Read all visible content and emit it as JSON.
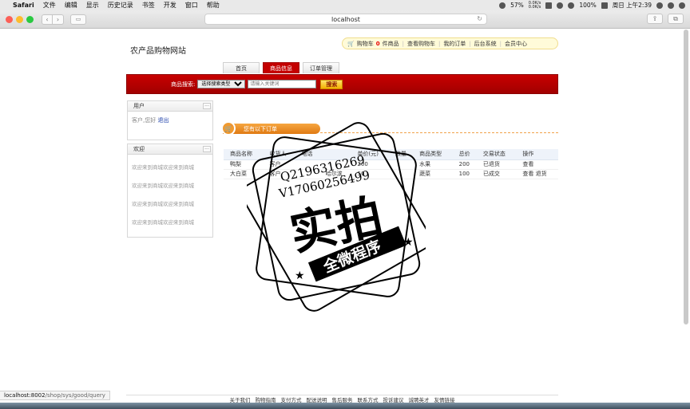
{
  "menubar": {
    "app": "Safari",
    "items": [
      "文件",
      "编辑",
      "显示",
      "历史记录",
      "书签",
      "开发",
      "窗口",
      "帮助"
    ],
    "battery_pct": "57%",
    "net_up": "0.0K/s",
    "net_down": "0.0K/s",
    "battery2": "100%",
    "clock": "周日 上午2:39"
  },
  "browser": {
    "url": "localhost",
    "status_host": "localhost:8002",
    "status_path": "/shop/sys/good/query"
  },
  "site": {
    "title": "农产品购物网站",
    "topbar": {
      "cart_label": "购物车",
      "cart_count": "0",
      "cart_unit": "件商品",
      "links": [
        "查看购物车",
        "我的订单",
        "后台系统",
        "会员中心"
      ]
    },
    "tabs": [
      "首页",
      "商品信息",
      "订单管理"
    ],
    "active_tab": 1,
    "search": {
      "label": "商品搜索:",
      "select_value": "选择搜索类型",
      "placeholder": "请输入关键词",
      "button": "搜索"
    }
  },
  "sidebar": {
    "user_panel": {
      "title": "用户",
      "greeting": "客户,您好",
      "logout": "退出",
      "more": "···"
    },
    "welcome_panel": {
      "title": "欢迎",
      "more": "···",
      "lines": [
        "欢迎来到商城欢迎来到商城",
        "欢迎来到商城欢迎来到商城",
        "欢迎来到商城欢迎来到商城",
        "欢迎来到商城欢迎来到商城"
      ]
    }
  },
  "orders": {
    "heading": "您有以下订单",
    "columns": [
      "商品名称",
      "收货人",
      "电话",
      "",
      "单价(元)",
      "数量",
      "商品类型",
      "总价",
      "交易状态",
      "操作"
    ],
    "rows": [
      {
        "name": "鸭梨",
        "receiver": "客户",
        "phone": "",
        "addr": "",
        "price": "200",
        "qty": "",
        "type": "水果",
        "total": "200",
        "status": "已退货",
        "ops": [
          "查看"
        ]
      },
      {
        "name": "大白菜",
        "receiver": "客户",
        "phone": "",
        "addr": "哈尔滨",
        "price": "50",
        "qty": "",
        "type": "蔬菜",
        "total": "100",
        "status": "已成交",
        "ops": [
          "查看",
          "退货"
        ]
      }
    ]
  },
  "watermark": {
    "line1": "Q2196316269",
    "line2": "V17060256499",
    "big": "实拍",
    "ribbon": "全微程序"
  },
  "footer": {
    "links": [
      "关于我们",
      "购物指南",
      "支付方式",
      "配送说明",
      "售后服务",
      "联系方式",
      "投诉建议",
      "诚聘英才",
      "友情链接"
    ]
  }
}
